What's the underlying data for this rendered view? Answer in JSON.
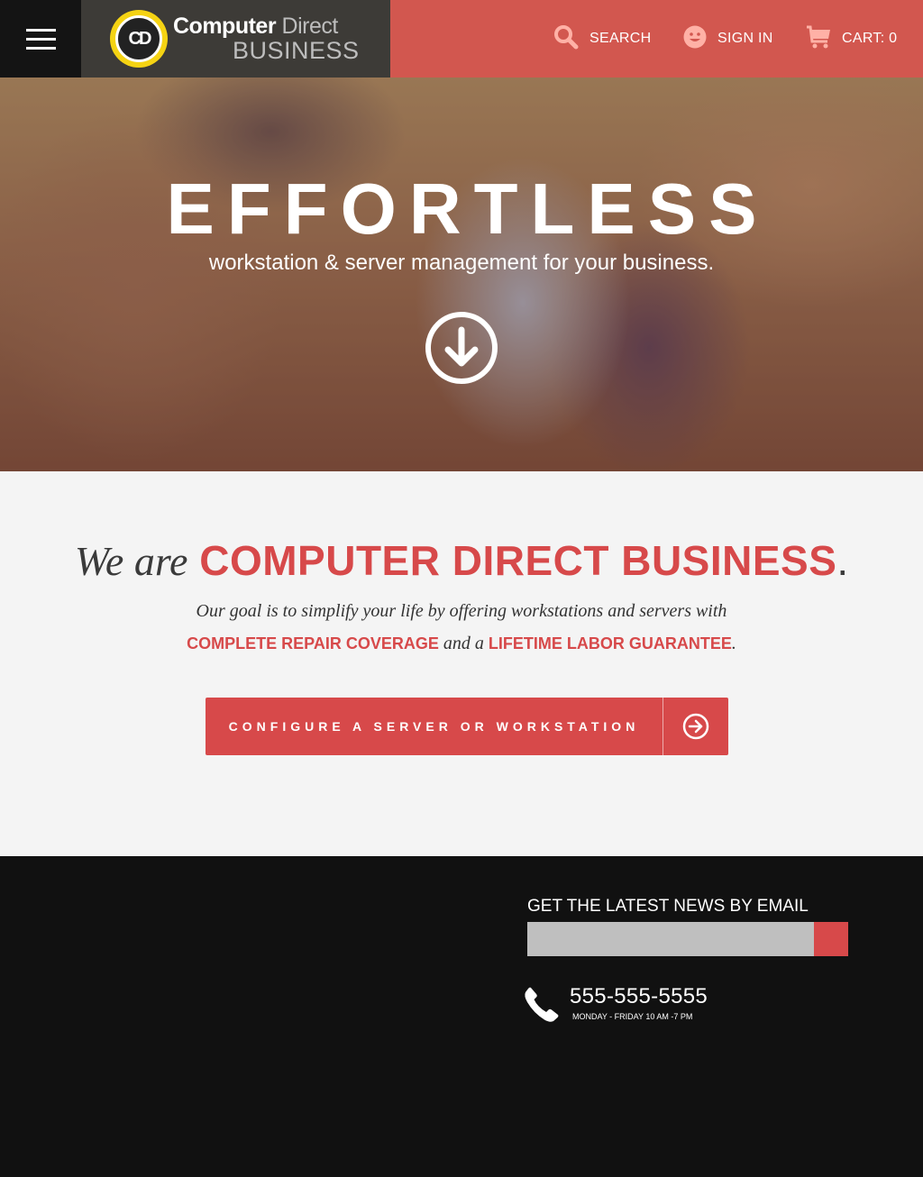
{
  "header": {
    "logo": {
      "line1_bold": "Computer",
      "line1_light": "Direct",
      "line2": "BUSINESS",
      "mark": "CD"
    },
    "nav": {
      "search_label": "SEARCH",
      "signin_label": "SIGN IN",
      "cart_label": "CART: 0"
    },
    "icons": [
      "hamburger-menu-icon",
      "search-icon",
      "smiley-icon",
      "cart-icon"
    ]
  },
  "hero": {
    "title": "EFFORTLESS",
    "subtitle": "workstation & server management for your business.",
    "arrow_icon": "arrow-down-circle-icon"
  },
  "intro": {
    "heading_italic": "We are",
    "heading_brand": "COMPUTER DIRECT BUSINESS",
    "heading_end": ".",
    "line1": "Our goal is to simplify your life by offering workstations and servers with",
    "highlight1": "COMPLETE REPAIR COVERAGE",
    "connector": "and a",
    "highlight2": "LIFETIME LABOR GUARANTEE",
    "line2_end": ".",
    "cta_label": "CONFIGURE A SERVER OR WORKSTATION",
    "cta_icon": "arrow-right-circle-icon"
  },
  "footer": {
    "newsletter_title": "GET THE LATEST NEWS BY EMAIL",
    "email_placeholder": "",
    "phone_number": "555-555-5555",
    "phone_hours": "MONDAY - FRIDAY 10 AM -7 PM",
    "phone_icon": "phone-icon"
  },
  "colors": {
    "accent": "#d7494a",
    "header_bg": "#d2574f",
    "dark": "#111111",
    "logo_yellow": "#f5d313"
  }
}
